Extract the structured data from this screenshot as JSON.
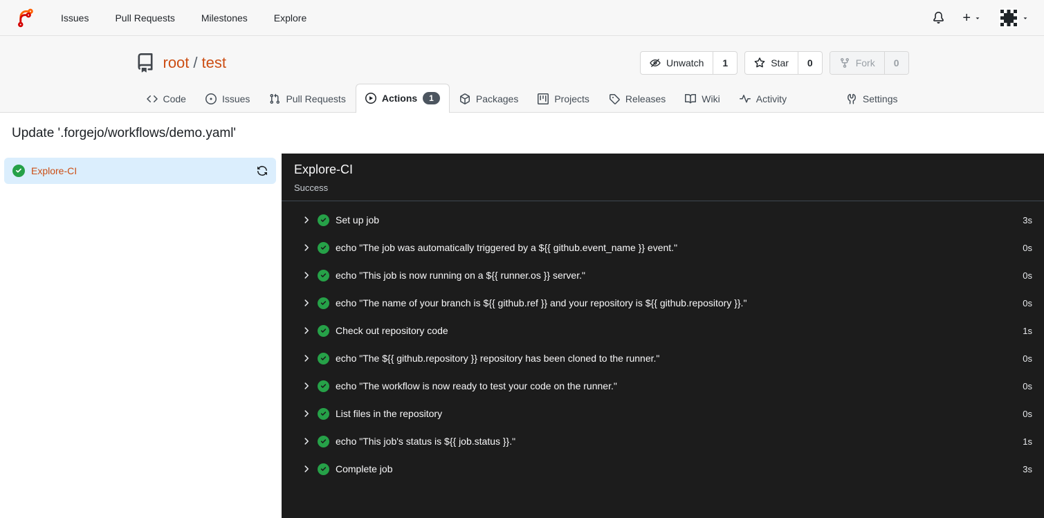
{
  "colors": {
    "header-bg": "#f7f7f7",
    "link-orange": "#cc4e14",
    "panel-bg": "#1c1c1c",
    "panel-divider": "#3f4750",
    "success-green": "#26a148",
    "selected-job-bg": "#dbeefd",
    "badge-bg": "#4c555f",
    "logo-orange": "#ff6000",
    "logo-red": "#d40000"
  },
  "nav": {
    "items": [
      {
        "label": "Issues"
      },
      {
        "label": "Pull Requests"
      },
      {
        "label": "Milestones"
      },
      {
        "label": "Explore"
      }
    ],
    "plus": "+"
  },
  "repo": {
    "owner": "root",
    "separator": "/",
    "name": "test",
    "watch": {
      "label": "Unwatch",
      "count": "1"
    },
    "star": {
      "label": "Star",
      "count": "0"
    },
    "fork": {
      "label": "Fork",
      "count": "0"
    },
    "tabs": [
      {
        "label": "Code"
      },
      {
        "label": "Issues"
      },
      {
        "label": "Pull Requests"
      },
      {
        "label": "Actions",
        "badge": "1"
      },
      {
        "label": "Packages"
      },
      {
        "label": "Projects"
      },
      {
        "label": "Releases"
      },
      {
        "label": "Wiki"
      },
      {
        "label": "Activity"
      },
      {
        "label": "Settings"
      }
    ]
  },
  "page": {
    "title": "Update '.forgejo/workflows/demo.yaml'"
  },
  "sidebar": {
    "job": {
      "name": "Explore-CI",
      "status": "success"
    }
  },
  "panel": {
    "title": "Explore-CI",
    "status": "Success",
    "steps": [
      {
        "name": "Set up job",
        "duration": "3s"
      },
      {
        "name": "echo \"The job was automatically triggered by a ${{ github.event_name }} event.\"",
        "duration": "0s"
      },
      {
        "name": "echo \"This job is now running on a ${{ runner.os }} server.\"",
        "duration": "0s"
      },
      {
        "name": "echo \"The name of your branch is ${{ github.ref }} and your repository is ${{ github.repository }}.\"",
        "duration": "0s"
      },
      {
        "name": "Check out repository code",
        "duration": "1s"
      },
      {
        "name": "echo \"The ${{ github.repository }} repository has been cloned to the runner.\"",
        "duration": "0s"
      },
      {
        "name": "echo \"The workflow is now ready to test your code on the runner.\"",
        "duration": "0s"
      },
      {
        "name": "List files in the repository",
        "duration": "0s"
      },
      {
        "name": "echo \"This job's status is ${{ job.status }}.\"",
        "duration": "1s"
      },
      {
        "name": "Complete job",
        "duration": "3s"
      }
    ]
  }
}
